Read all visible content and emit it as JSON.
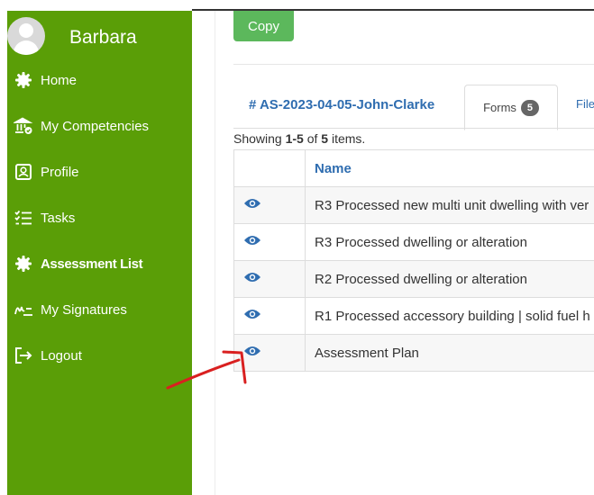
{
  "sidebar": {
    "user_name": "Barbara",
    "items": [
      {
        "label": "Home",
        "icon": "gear-icon"
      },
      {
        "label": "My Competencies",
        "icon": "bank-verified-icon"
      },
      {
        "label": "Profile",
        "icon": "profile-card-icon"
      },
      {
        "label": "Tasks",
        "icon": "checklist-icon"
      },
      {
        "label": "Assessment List",
        "icon": "gear-icon",
        "active": true
      },
      {
        "label": "My Signatures",
        "icon": "signature-icon"
      },
      {
        "label": "Logout",
        "icon": "logout-icon"
      }
    ],
    "background_color": "#5a9e07"
  },
  "toolbar": {
    "copy_label": "Copy",
    "copy_color": "#5cb85c"
  },
  "tabs": {
    "assessment_id": "# AS-2023-04-05-John-Clarke",
    "forms_label": "Forms",
    "forms_count": "5",
    "files_label": "File"
  },
  "summary": {
    "prefix": "Showing ",
    "range": "1-5",
    "middle": " of ",
    "total": "5",
    "suffix": " items."
  },
  "table": {
    "headers": [
      "",
      "Name"
    ],
    "rows": [
      {
        "name": "R3 Processed new multi unit dwelling with ver"
      },
      {
        "name": "R3 Processed dwelling or alteration"
      },
      {
        "name": "R2 Processed dwelling or alteration"
      },
      {
        "name": "R1 Processed accessory building | solid fuel h"
      },
      {
        "name": "Assessment Plan"
      }
    ]
  },
  "annotation": {
    "arrow_color": "#d92020"
  }
}
